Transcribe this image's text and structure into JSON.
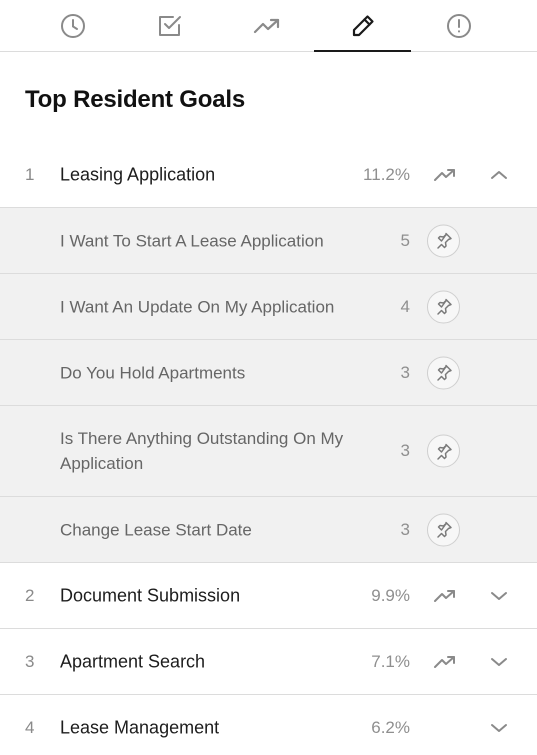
{
  "tabs": [
    {
      "icon": "clock-icon",
      "active": false
    },
    {
      "icon": "checkbox-icon",
      "active": false
    },
    {
      "icon": "trending-up-icon",
      "active": false
    },
    {
      "icon": "pencil-icon",
      "active": true
    },
    {
      "icon": "alert-circle-icon",
      "active": false
    }
  ],
  "page": {
    "title": "Top Resident Goals"
  },
  "goals": [
    {
      "rank": "1",
      "label": "Leasing Application",
      "percent": "11.2%",
      "expanded": true,
      "subgoals": [
        {
          "label": "I Want To Start A Lease Application",
          "count": "5"
        },
        {
          "label": "I Want An Update On My Application",
          "count": "4"
        },
        {
          "label": "Do You Hold Apartments",
          "count": "3"
        },
        {
          "label": "Is There Anything Outstanding On My Application",
          "count": "3"
        },
        {
          "label": "Change Lease Start Date",
          "count": "3"
        }
      ]
    },
    {
      "rank": "2",
      "label": "Document Submission",
      "percent": "9.9%",
      "expanded": false
    },
    {
      "rank": "3",
      "label": "Apartment Search",
      "percent": "7.1%",
      "expanded": false
    },
    {
      "rank": "4",
      "label": "Lease Management",
      "percent": "6.2%",
      "expanded": false
    }
  ],
  "colors": {
    "accent": "#1a1a1a",
    "icon": "#8a8a8a",
    "expanded_bg": "#f1f1f1",
    "divider": "#dcdcdc"
  }
}
